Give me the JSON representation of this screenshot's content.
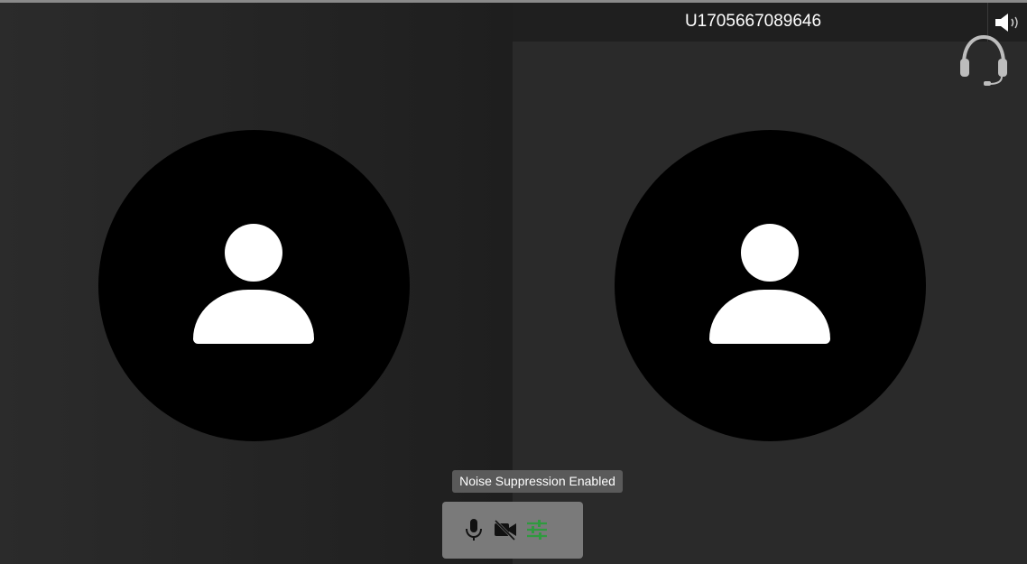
{
  "participants": [
    {
      "name": "",
      "avatar_icon": "person-silhouette-icon"
    },
    {
      "name": "U1705667089646",
      "avatar_icon": "person-silhouette-icon"
    }
  ],
  "header": {
    "speaker_icon": "speaker-volume-icon",
    "headset_icon": "headset-icon"
  },
  "tooltip": {
    "text": "Noise Suppression Enabled"
  },
  "toolbar": {
    "buttons": [
      {
        "id": "mic",
        "icon": "microphone-icon"
      },
      {
        "id": "camera",
        "icon": "camera-off-icon"
      },
      {
        "id": "noise_suppression",
        "icon": "sliders-icon",
        "active": true
      }
    ]
  },
  "colors": {
    "background": "#232323",
    "avatar_circle": "#000000",
    "noise_suppression_active": "#2f9a3f",
    "toolbar_bg": "#7a7a7a",
    "tooltip_bg": "#5a5a5a"
  }
}
